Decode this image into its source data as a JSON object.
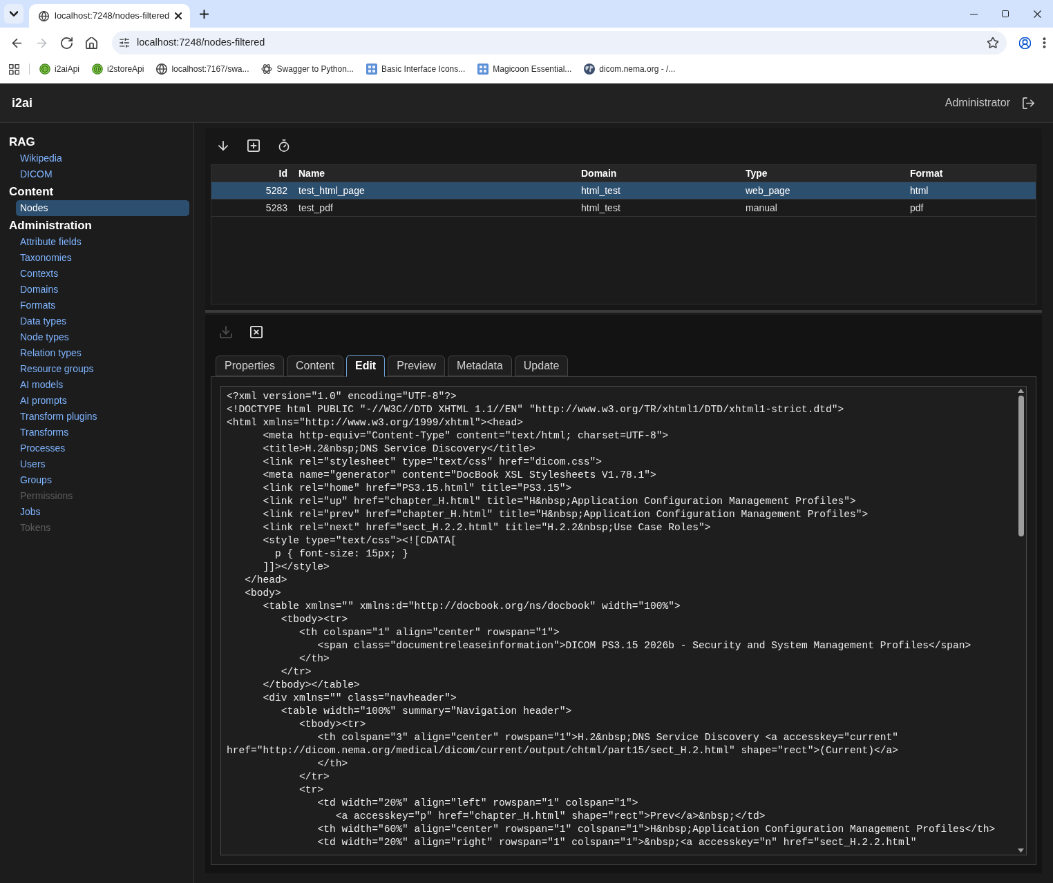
{
  "browser": {
    "tabs": [
      {
        "title": "localhost:7248/nodes-filtered",
        "selected": true
      }
    ],
    "nav_buttons": [
      {
        "disabled": false
      },
      {
        "disabled": true
      },
      {
        "disabled": false
      },
      {
        "disabled": false
      }
    ],
    "address": "localhost:7248/nodes-filtered",
    "bookmarks": [
      {
        "label": "i2aiApi"
      },
      {
        "label": "i2storeApi"
      },
      {
        "label": "localhost:7167/swa..."
      },
      {
        "label": "Swagger to Python..."
      },
      {
        "label": "Basic Interface Icons..."
      },
      {
        "label": "Magicoon Essential..."
      },
      {
        "label": "dicom.nema.org - /..."
      }
    ]
  },
  "app": {
    "title": "i2ai",
    "user": "Administrator"
  },
  "sidebar": {
    "sections": [
      {
        "title": "RAG",
        "items": [
          {
            "label": "Wikipedia",
            "selected": false,
            "disabled": false
          },
          {
            "label": "DICOM",
            "selected": false,
            "disabled": false
          }
        ]
      },
      {
        "title": "Content",
        "items": [
          {
            "label": "Nodes",
            "selected": true,
            "disabled": false
          }
        ]
      },
      {
        "title": "Administration",
        "items": [
          {
            "label": "Attribute fields",
            "selected": false,
            "disabled": false
          },
          {
            "label": "Taxonomies",
            "selected": false,
            "disabled": false
          },
          {
            "label": "Contexts",
            "selected": false,
            "disabled": false
          },
          {
            "label": "Domains",
            "selected": false,
            "disabled": false
          },
          {
            "label": "Formats",
            "selected": false,
            "disabled": false
          },
          {
            "label": "Data types",
            "selected": false,
            "disabled": false
          },
          {
            "label": "Node types",
            "selected": false,
            "disabled": false
          },
          {
            "label": "Relation types",
            "selected": false,
            "disabled": false
          },
          {
            "label": "Resource groups",
            "selected": false,
            "disabled": false
          },
          {
            "label": "AI models",
            "selected": false,
            "disabled": false
          },
          {
            "label": "AI prompts",
            "selected": false,
            "disabled": false
          },
          {
            "label": "Transform plugins",
            "selected": false,
            "disabled": false
          },
          {
            "label": "Transforms",
            "selected": false,
            "disabled": false
          },
          {
            "label": "Processes",
            "selected": false,
            "disabled": false
          },
          {
            "label": "Users",
            "selected": false,
            "disabled": false
          },
          {
            "label": "Groups",
            "selected": false,
            "disabled": false
          },
          {
            "label": "Permissions",
            "selected": false,
            "disabled": true
          },
          {
            "label": "Jobs",
            "selected": false,
            "disabled": false
          },
          {
            "label": "Tokens",
            "selected": false,
            "disabled": true
          }
        ]
      }
    ]
  },
  "nodes_table": {
    "columns": [
      "Id",
      "Name",
      "Domain",
      "Type",
      "Format"
    ],
    "rows": [
      {
        "cells": [
          "5282",
          "test_html_page",
          "html_test",
          "web_page",
          "html"
        ],
        "selected": true
      },
      {
        "cells": [
          "5283",
          "test_pdf",
          "html_test",
          "manual",
          "pdf"
        ],
        "selected": false
      }
    ]
  },
  "detail": {
    "actions": [
      {
        "disabled": true
      },
      {
        "disabled": false
      }
    ],
    "tabs": [
      {
        "label": "Properties",
        "selected": false
      },
      {
        "label": "Content",
        "selected": false
      },
      {
        "label": "Edit",
        "selected": true
      },
      {
        "label": "Preview",
        "selected": false
      },
      {
        "label": "Metadata",
        "selected": false
      },
      {
        "label": "Update",
        "selected": false
      }
    ],
    "editor": {
      "lines": [
        "<?xml version=\"1.0\" encoding=\"UTF-8\"?>",
        "<!DOCTYPE html PUBLIC \"-//W3C//DTD XHTML 1.1//EN\" \"http://www.w3.org/TR/xhtml1/DTD/xhtml1-strict.dtd\">",
        "<html xmlns=\"http://www.w3.org/1999/xhtml\"><head>",
        "      <meta http-equiv=\"Content-Type\" content=\"text/html; charset=UTF-8\">",
        "      <title>H.2&nbsp;DNS Service Discovery</title>",
        "      <link rel=\"stylesheet\" type=\"text/css\" href=\"dicom.css\">",
        "      <meta name=\"generator\" content=\"DocBook XSL Stylesheets V1.78.1\">",
        "      <link rel=\"home\" href=\"PS3.15.html\" title=\"PS3.15\">",
        "      <link rel=\"up\" href=\"chapter_H.html\" title=\"H&nbsp;Application Configuration Management Profiles\">",
        "      <link rel=\"prev\" href=\"chapter_H.html\" title=\"H&nbsp;Application Configuration Management Profiles\">",
        "      <link rel=\"next\" href=\"sect_H.2.2.html\" title=\"H.2.2&nbsp;Use Case Roles\">",
        "      <style type=\"text/css\"><![CDATA[",
        "        p { font-size: 15px; }",
        "      ]]></style>",
        "   </head>",
        "   <body>",
        "      <table xmlns=\"\" xmlns:d=\"http://docbook.org/ns/docbook\" width=\"100%\">",
        "         <tbody><tr>",
        "            <th colspan=\"1\" align=\"center\" rowspan=\"1\">",
        "               <span class=\"documentreleaseinformation\">DICOM PS3.15 2026b - Security and System Management Profiles</span>",
        "            </th>",
        "         </tr>",
        "      </tbody></table>",
        "      <div xmlns=\"\" class=\"navheader\">",
        "         <table width=\"100%\" summary=\"Navigation header\">",
        "            <tbody><tr>",
        "               <th colspan=\"3\" align=\"center\" rowspan=\"1\">H.2&nbsp;DNS Service Discovery <a accesskey=\"current\"",
        "href=\"http://dicom.nema.org/medical/dicom/current/output/chtml/part15/sect_H.2.html\" shape=\"rect\">(Current)</a>",
        "               </th>",
        "            </tr>",
        "            <tr>",
        "               <td width=\"20%\" align=\"left\" rowspan=\"1\" colspan=\"1\">",
        "                  <a accesskey=\"p\" href=\"chapter_H.html\" shape=\"rect\">Prev</a>&nbsp;</td>",
        "               <th width=\"60%\" align=\"center\" rowspan=\"1\" colspan=\"1\">H&nbsp;Application Configuration Management Profiles</th>",
        "               <td width=\"20%\" align=\"right\" rowspan=\"1\" colspan=\"1\">&nbsp;<a accesskey=\"n\" href=\"sect_H.2.2.html\""
      ]
    }
  }
}
